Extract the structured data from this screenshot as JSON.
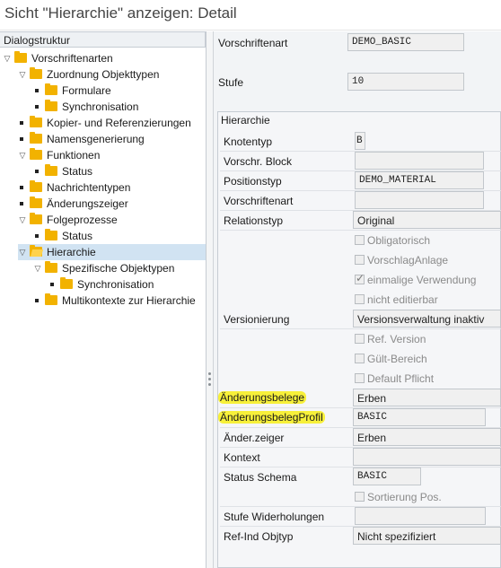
{
  "window": {
    "title": "Sicht \"Hierarchie\" anzeigen: Detail"
  },
  "tree": {
    "header": "Dialogstruktur",
    "nodes": [
      {
        "label": "Vorschriftenarten"
      },
      {
        "label": "Zuordnung Objekttypen"
      },
      {
        "label": "Formulare"
      },
      {
        "label": "Synchronisation"
      },
      {
        "label": "Kopier- und Referenzierungen"
      },
      {
        "label": "Namensgenerierung"
      },
      {
        "label": "Funktionen"
      },
      {
        "label": "Status"
      },
      {
        "label": "Nachrichtentypen"
      },
      {
        "label": "Änderungszeiger"
      },
      {
        "label": "Folgeprozesse"
      },
      {
        "label": "Status"
      },
      {
        "label": "Hierarchie"
      },
      {
        "label": "Spezifische Objektypen"
      },
      {
        "label": "Synchronisation"
      },
      {
        "label": "Multikontexte zur Hierarchie"
      }
    ]
  },
  "header_fields": {
    "vorschriftenart_label": "Vorschriftenart",
    "vorschriftenart_value": "DEMO_BASIC",
    "stufe_label": "Stufe",
    "stufe_value": "10"
  },
  "hierarchie": {
    "title": "Hierarchie",
    "knotentyp_label": "Knotentyp",
    "knotentyp_value": "B",
    "vorschr_block_label": "Vorschr. Block",
    "vorschr_block_value": "",
    "positionstyp_label": "Positionstyp",
    "positionstyp_value": "DEMO_MATERIAL",
    "vorschriftenart_label": "Vorschriftenart",
    "vorschriftenart_value": "",
    "relationstyp_label": "Relationstyp",
    "relationstyp_value": "Original",
    "obligatorisch": "Obligatorisch",
    "vorschlag_anlage": "VorschlagAnlage",
    "einmalige_verwendung": "einmalige Verwendung",
    "nicht_editierbar": "nicht editierbar",
    "versionierung_label": "Versionierung",
    "versionierung_value": "Versionsverwaltung inaktiv",
    "ref_version": "Ref. Version",
    "guelt_bereich": "Gült-Bereich",
    "default_pflicht": "Default Pflicht",
    "aenderungsbelege_label": "Änderungsbelege",
    "aenderungsbelege_value": "Erben",
    "aenderungsbelegprofil_label": "ÄnderungsbelegProfil",
    "aenderungsbelegprofil_value": "BASIC",
    "aender_zeiger_label": "Änder.zeiger",
    "aender_zeiger_value": "Erben",
    "kontext_label": "Kontext",
    "kontext_value": "",
    "status_schema_label": "Status Schema",
    "status_schema_value": "BASIC",
    "sortierung_pos": "Sortierung Pos.",
    "stufe_wiederholungen_label": "Stufe Widerholungen",
    "stufe_wiederholungen_value": "",
    "ref_ind_objtyp_label": "Ref-Ind Objtyp",
    "ref_ind_objtyp_value": "Nicht spezifiziert"
  },
  "colors": {
    "highlight": "#f7f03a",
    "folder": "#f2b200",
    "selection": "#d1e3f2"
  }
}
